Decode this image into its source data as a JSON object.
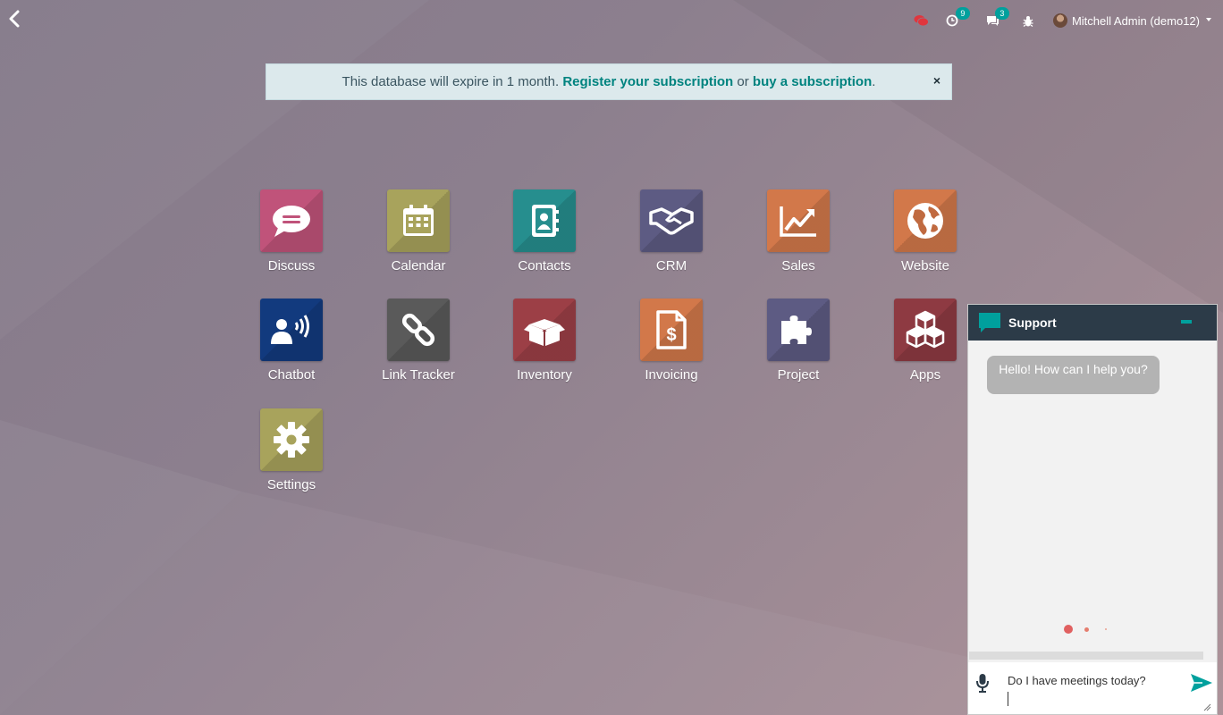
{
  "topbar": {
    "back_icon": "chevron-left-icon",
    "livechat_icon": "livechat-bubbles-icon",
    "activity_icon": "clock-icon",
    "activity_count": "9",
    "messages_icon": "comments-icon",
    "messages_count": "3",
    "debug_icon": "bug-icon",
    "user_name": "Mitchell Admin (demo12)"
  },
  "banner": {
    "text_before": "This database will expire in 1 month.",
    "register_link": "Register your subscription",
    "text_or": "or",
    "buy_link": "buy a subscription",
    "text_end": ".",
    "close": "×"
  },
  "apps": [
    {
      "label": "Discuss",
      "icon": "chat-bubble-icon",
      "color": "#c0537a"
    },
    {
      "label": "Calendar",
      "icon": "calendar-icon",
      "color": "#a8a35c"
    },
    {
      "label": "Contacts",
      "icon": "address-book-icon",
      "color": "#268e8e"
    },
    {
      "label": "CRM",
      "icon": "handshake-icon",
      "color": "#5d5b83"
    },
    {
      "label": "Sales",
      "icon": "chart-line-icon",
      "color": "#d2784a"
    },
    {
      "label": "Website",
      "icon": "globe-icon",
      "color": "#d2784a"
    },
    {
      "label": "Chatbot",
      "icon": "chatbot-speaker-icon",
      "color": "#123a7e"
    },
    {
      "label": "Link Tracker",
      "icon": "link-icon",
      "color": "#5a5a5a"
    },
    {
      "label": "Inventory",
      "icon": "box-icon",
      "color": "#9c3f46"
    },
    {
      "label": "Invoicing",
      "icon": "invoice-dollar-icon",
      "color": "#d2784a"
    },
    {
      "label": "Project",
      "icon": "puzzle-icon",
      "color": "#5d5b83"
    },
    {
      "label": "Apps",
      "icon": "cubes-icon",
      "color": "#8e3a42"
    },
    {
      "label": "Settings",
      "icon": "gear-icon",
      "color": "#a8a35c"
    }
  ],
  "chat": {
    "title": "Support",
    "header_icon": "chat-square-icon",
    "minimize_icon": "minimize-icon",
    "bot_message": "Hello! How can I help you?",
    "input_value": "Do I have meetings today?",
    "mic_icon": "microphone-icon",
    "send_icon": "send-arrow-icon",
    "accent_color": "#00a09d",
    "typing_color": "#e06060"
  }
}
